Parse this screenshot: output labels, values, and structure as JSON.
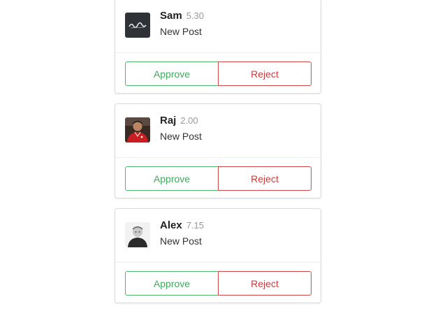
{
  "posts": [
    {
      "user": "Sam",
      "score": "5.30",
      "text": "New Post",
      "avatar_icon": "dark-logo-avatar",
      "approve_label": "Approve",
      "reject_label": "Reject"
    },
    {
      "user": "Raj",
      "score": "2.00",
      "text": "New Post",
      "avatar_icon": "photo-avatar-red-shirt",
      "approve_label": "Approve",
      "reject_label": "Reject"
    },
    {
      "user": "Alex",
      "score": "7.15",
      "text": "New Post",
      "avatar_icon": "photo-avatar-grayscale",
      "approve_label": "Approve",
      "reject_label": "Reject"
    }
  ],
  "colors": {
    "approve": "#3daa5c",
    "reject": "#c83c3c",
    "card_border": "#dcdcdc"
  }
}
